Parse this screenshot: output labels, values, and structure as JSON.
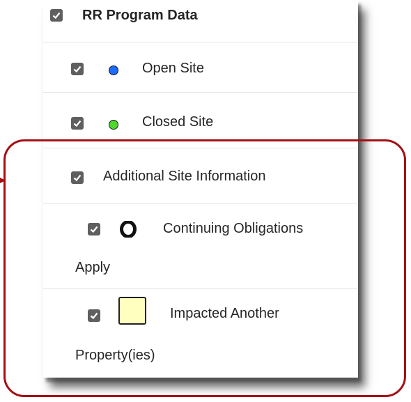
{
  "layer_list": {
    "group": {
      "label": "RR Program Data",
      "checked": true
    },
    "items": [
      {
        "label": "Open Site",
        "checked": true,
        "symbol_color": "#1a6bff",
        "icon": "blue-dot-icon"
      },
      {
        "label": "Closed Site",
        "checked": true,
        "symbol_color": "#4ed82b",
        "icon": "green-dot-icon"
      }
    ],
    "subgroup": {
      "label": "Additional Site Information",
      "checked": true
    },
    "subitems": [
      {
        "label_line1": "Continuing Obligations",
        "label_line2": "Apply",
        "checked": true,
        "icon": "black-ring-icon"
      },
      {
        "label_line1": "Impacted Another",
        "label_line2": "Property(ies)",
        "checked": true,
        "symbol_color": "#ffffc0",
        "icon": "yellow-square-icon"
      }
    ]
  },
  "colors": {
    "highlight": "#a40f14",
    "checkbox": "#5f5f5f"
  }
}
